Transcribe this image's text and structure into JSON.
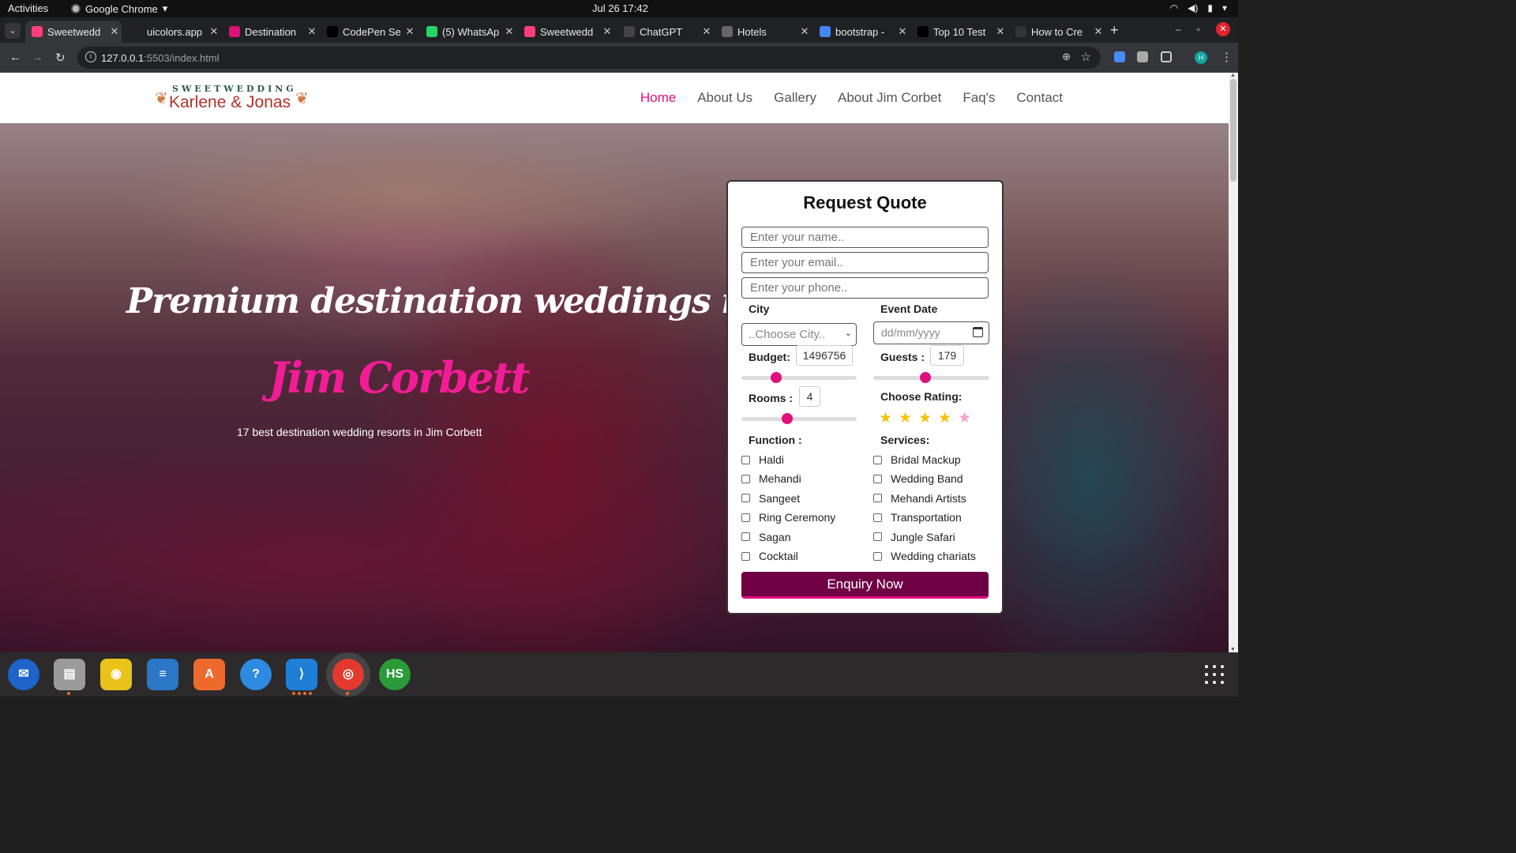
{
  "system": {
    "activities": "Activities",
    "app_name": "Google Chrome",
    "clock": "Jul 26  17:42"
  },
  "browser": {
    "tabs": [
      {
        "title": "Sweetwedd",
        "active": true,
        "favicon_color": "#ff3e7a"
      },
      {
        "title": "uicolors.app",
        "active": false,
        "favicon_color": "#222222"
      },
      {
        "title": "Destination",
        "active": false,
        "favicon_color": "#e0107a"
      },
      {
        "title": "CodePen Se",
        "active": false,
        "favicon_color": "#000000"
      },
      {
        "title": "(5) WhatsAp",
        "active": false,
        "favicon_color": "#25d366"
      },
      {
        "title": "Sweetwedd",
        "active": false,
        "favicon_color": "#ff3e7a"
      },
      {
        "title": "ChatGPT",
        "active": false,
        "favicon_color": "#444444"
      },
      {
        "title": "Hotels",
        "active": false,
        "favicon_color": "#666666"
      },
      {
        "title": "bootstrap -",
        "active": false,
        "favicon_color": "#4285f4"
      },
      {
        "title": "Top 10 Test",
        "active": false,
        "favicon_color": "#000000"
      },
      {
        "title": "How to Cre",
        "active": false,
        "favicon_color": "#333333"
      }
    ],
    "url_host": "127.0.0.1",
    "url_rest": ":5503/index.html"
  },
  "site": {
    "logo_top": "SWEETWEDDING",
    "logo_bottom": "Karlene & Jonas",
    "nav": [
      {
        "label": "Home",
        "active": true
      },
      {
        "label": "About Us",
        "active": false
      },
      {
        "label": "Gallery",
        "active": false
      },
      {
        "label": "About Jim Corbet",
        "active": false
      },
      {
        "label": "Faq's",
        "active": false
      },
      {
        "label": "Contact",
        "active": false
      }
    ],
    "hero": {
      "title_line1": "Premium destination weddings in",
      "title_line2": "Jim Corbett",
      "subtitle": "17 best destination wedding resorts in Jim Corbett"
    }
  },
  "quote_form": {
    "title": "Request Quote",
    "name_placeholder": "Enter your name..",
    "email_placeholder": "Enter your email..",
    "phone_placeholder": "Enter your phone..",
    "city_label": "City",
    "city_value": "..Choose City..",
    "event_date_label": "Event Date",
    "event_date_placeholder": "dd/mm/yyyy",
    "budget_label": "Budget:",
    "budget_value": "1496756",
    "budget_slider_fraction": 0.3,
    "guests_label": "Guests :",
    "guests_value": "179",
    "guests_slider_fraction": 0.45,
    "rooms_label": "Rooms :",
    "rooms_value": "4",
    "rooms_slider_fraction": 0.4,
    "rating_label": "Choose Rating:",
    "rating_value": 4,
    "rating_max": 5,
    "function_label": "Function :",
    "functions": [
      "Haldi",
      "Mehandi",
      "Sangeet",
      "Ring Ceremony",
      "Sagan",
      "Cocktail"
    ],
    "services_label": "Services:",
    "services": [
      "Bridal Mackup",
      "Wedding Band",
      "Mehandi Artists",
      "Transportation",
      "Jungle Safari",
      "Wedding chariats"
    ],
    "submit_label": "Enquiry Now"
  },
  "colors": {
    "accent_pink": "#e0107a",
    "button_bg": "#700044",
    "star_filled": "#f4c20d",
    "star_empty": "#f5a3c9"
  },
  "dock": [
    {
      "name": "thunderbird",
      "glyph": "✉",
      "color": "#1d63c9"
    },
    {
      "name": "files",
      "glyph": "▤",
      "color": "#9b9b9b"
    },
    {
      "name": "rhythmbox",
      "glyph": "◉",
      "color": "#e9c21a"
    },
    {
      "name": "writer",
      "glyph": "≡",
      "color": "#2a76c7"
    },
    {
      "name": "software",
      "glyph": "A",
      "color": "#ee6a2c"
    },
    {
      "name": "help",
      "glyph": "?",
      "color": "#2d8ae0"
    },
    {
      "name": "vscode",
      "glyph": "⟩",
      "color": "#1f7fd6"
    },
    {
      "name": "chrome",
      "glyph": "◎",
      "color": "#e4392e"
    },
    {
      "name": "hs",
      "glyph": "HS",
      "color": "#2b9b3a"
    }
  ]
}
